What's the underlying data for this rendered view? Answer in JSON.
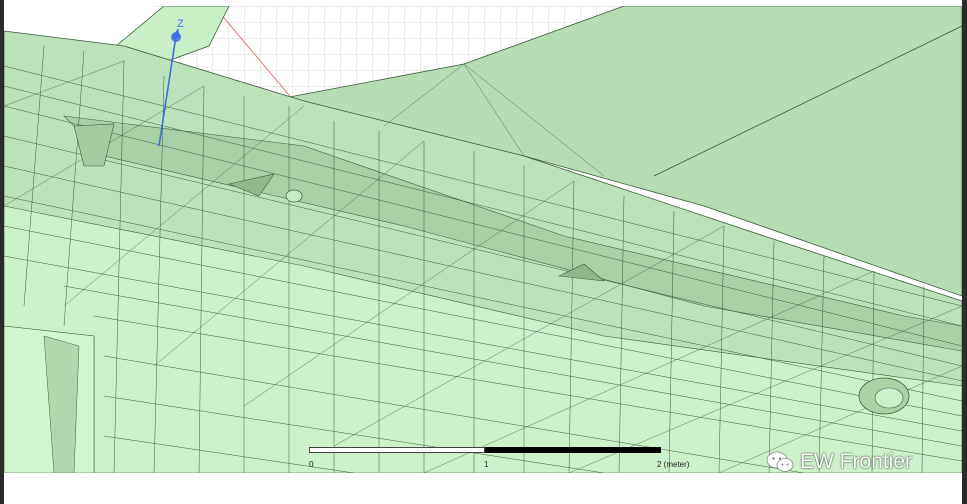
{
  "viewer": {
    "axis_label": "Z",
    "scale_bar": {
      "tick_0": "0",
      "tick_1": "1",
      "tick_2": "2 (meter)"
    }
  },
  "watermark": {
    "text": "EW Frontier",
    "icon": "wechat-icon"
  },
  "colors": {
    "mesh_fill": "#b9dfb9",
    "mesh_light": "#d2f5d2",
    "mesh_dark": "#9ec69e",
    "mesh_line": "#3c5c3c",
    "grid_line": "#d6d6d6",
    "axis_color": "#3a6fe8",
    "frame": "#2b2b2b"
  }
}
